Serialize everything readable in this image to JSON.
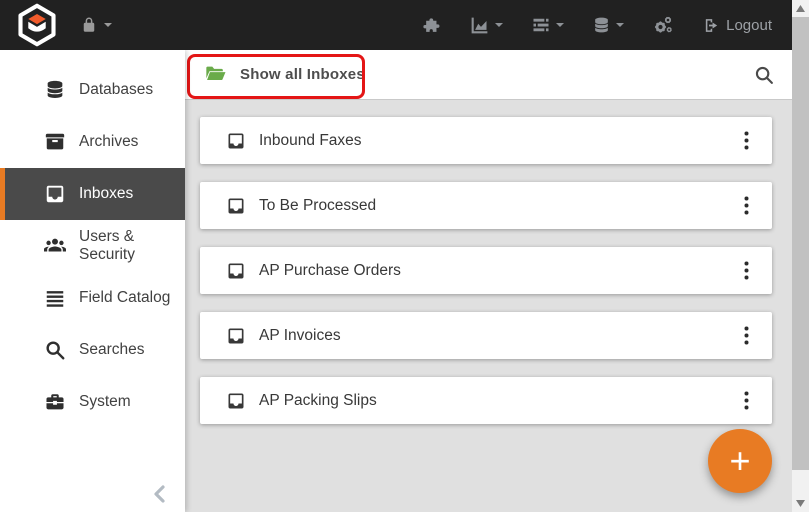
{
  "topbar": {
    "logout_label": "Logout",
    "icons": [
      "lock-icon",
      "puzzle-piece-icon",
      "area-chart-icon",
      "tasks-icon",
      "database-icon",
      "cogs-icon",
      "logout-icon"
    ]
  },
  "sidebar": {
    "items": [
      {
        "label": "Databases",
        "icon": "database-icon",
        "selected": false
      },
      {
        "label": "Archives",
        "icon": "archive-icon",
        "selected": false
      },
      {
        "label": "Inboxes",
        "icon": "inbox-icon",
        "selected": true
      },
      {
        "label": "Users & Security",
        "icon": "users-icon",
        "selected": false
      },
      {
        "label": "Field Catalog",
        "icon": "list-icon",
        "selected": false
      },
      {
        "label": "Searches",
        "icon": "search-icon",
        "selected": false
      },
      {
        "label": "System",
        "icon": "toolbox-icon",
        "selected": false
      }
    ]
  },
  "header": {
    "show_all_label": "Show all Inboxes",
    "folder_icon": "folder-open-icon",
    "search_icon": "search-icon"
  },
  "inboxes": [
    {
      "label": "Inbound Faxes"
    },
    {
      "label": "To Be Processed"
    },
    {
      "label": "AP Purchase Orders"
    },
    {
      "label": "AP Invoices"
    },
    {
      "label": "AP Packing Slips"
    }
  ],
  "fab": {
    "label": "+"
  },
  "colors": {
    "accent_orange": "#e87b23",
    "logo_orange": "#f15b2b",
    "annotation_red": "#e41616",
    "folder_green": "#6aab4a",
    "topbar_bg": "#212121",
    "selected_bg": "#4a4a4a",
    "content_bg": "#e0e0e0"
  }
}
